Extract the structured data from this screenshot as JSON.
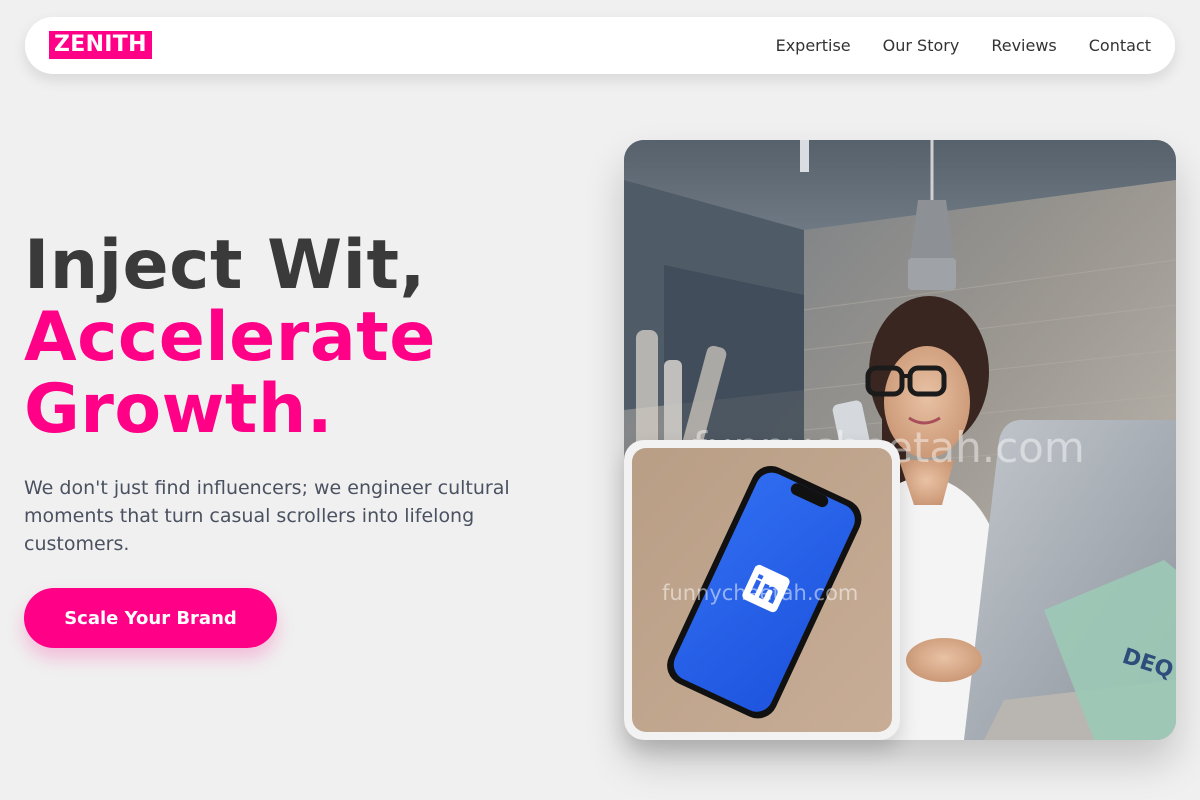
{
  "brand": {
    "logo": "ZENITH",
    "accent": "#ff0087"
  },
  "nav": {
    "links": [
      {
        "label": "Expertise"
      },
      {
        "label": "Our Story"
      },
      {
        "label": "Reviews"
      },
      {
        "label": "Contact"
      }
    ]
  },
  "hero": {
    "headline_line1": "Inject Wit,",
    "headline_line2": "Accelerate",
    "headline_line3": "Growth.",
    "subtext": "We don't just find influencers; we engineer cultural moments that turn casual scrollers into lifelong customers.",
    "cta_label": "Scale Your Brand"
  },
  "media": {
    "main_photo_watermark": "funnycheetah.com",
    "small_photo_watermark": "funnycheetah.com",
    "small_photo_logo": "in"
  }
}
